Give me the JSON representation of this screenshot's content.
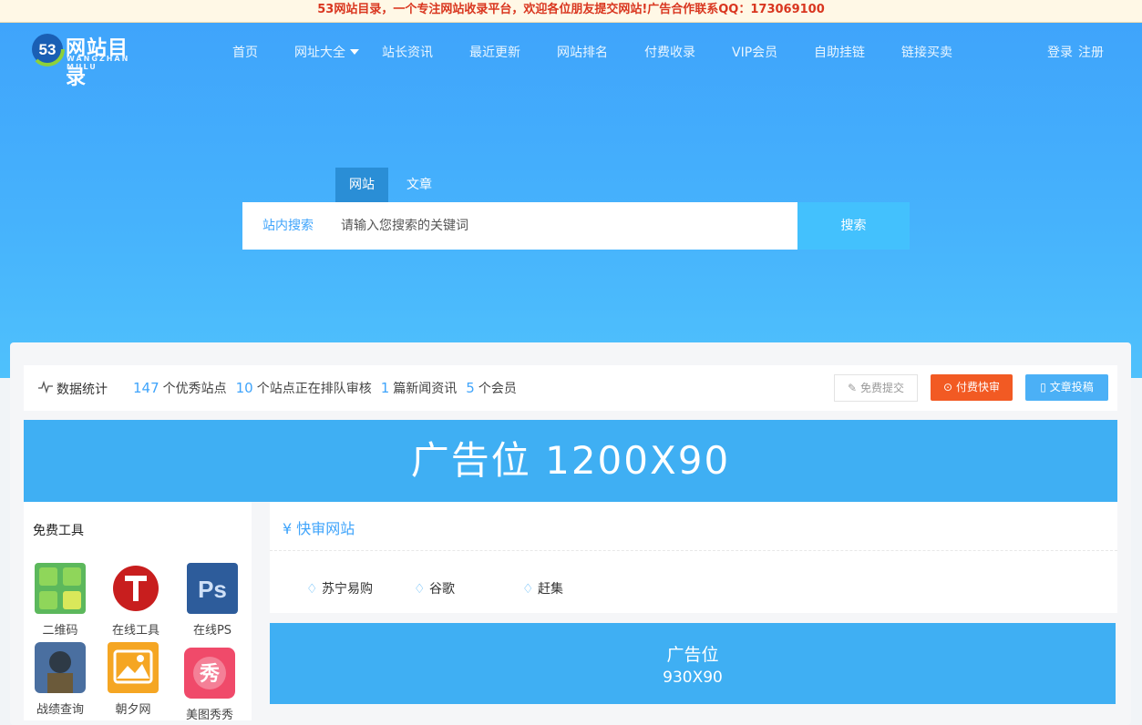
{
  "topbar": {
    "notice": "53网站目录，一个专注网站收录平台，欢迎各位朋友提交网站!广告合作联系QQ：173069100"
  },
  "logo": {
    "title": "网站目录",
    "subtitle": "WANGZHAN MULU"
  },
  "nav": {
    "items": [
      "首页",
      "网址大全",
      "站长资讯",
      "最近更新",
      "网站排名",
      "付费收录",
      "VIP会员",
      "自助挂链",
      "链接买卖"
    ],
    "login": "登录",
    "register": "注册"
  },
  "search": {
    "tabs": [
      "网站",
      "文章"
    ],
    "label": "站内搜索",
    "placeholder": "请输入您搜索的关键词",
    "button": "搜索"
  },
  "stats": {
    "title": "数据统计",
    "sites_count": "147",
    "sites_text": "个优秀站点",
    "pending_count": "10",
    "pending_text": "个站点正在排队审核",
    "news_count": "1",
    "news_text": "篇新闻资讯",
    "members_count": "5",
    "members_text": "个会员",
    "btn_free": "免费提交",
    "btn_paid": "付费快审",
    "btn_article": "文章投稿"
  },
  "ad_banner": {
    "text": "广告位  1200X90"
  },
  "tools": {
    "title": "免费工具",
    "items": [
      "二维码",
      "在线工具",
      "在线PS",
      "战绩查询",
      "朝夕网",
      "美图秀秀"
    ]
  },
  "quick": {
    "title": "快审网站",
    "items": [
      "苏宁易购",
      "谷歌",
      "赶集"
    ]
  },
  "ad_small": {
    "line1": "广告位",
    "line2": "930X90"
  },
  "colors": {
    "accent": "#3fa4fb",
    "paid": "#f25a23",
    "notice": "#d9361f"
  }
}
